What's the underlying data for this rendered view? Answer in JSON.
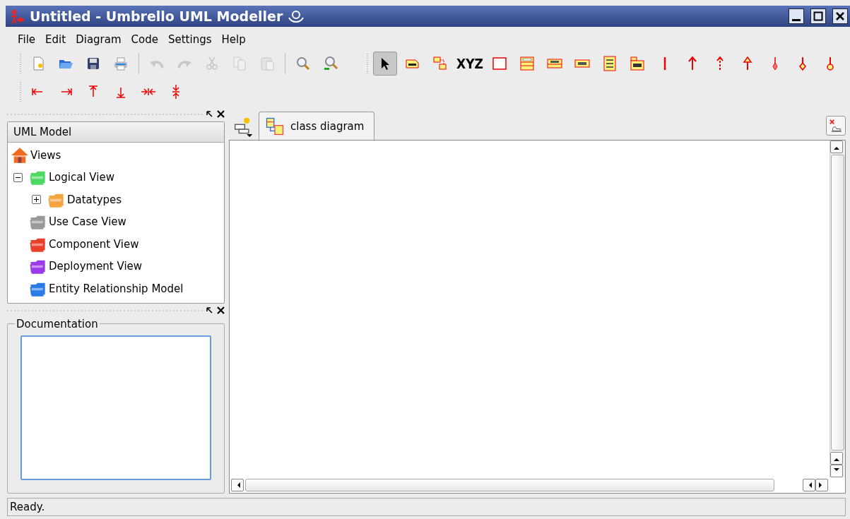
{
  "window": {
    "title": "Untitled - Umbrello UML Modeller"
  },
  "menu": [
    "File",
    "Edit",
    "Diagram",
    "Code",
    "Settings",
    "Help"
  ],
  "toolbar_main": [
    {
      "kind": "new",
      "disabled": false
    },
    {
      "kind": "open",
      "disabled": false
    },
    {
      "kind": "save",
      "disabled": false
    },
    {
      "kind": "print",
      "disabled": false
    },
    {
      "kind": "separator"
    },
    {
      "kind": "undo",
      "disabled": true
    },
    {
      "kind": "redo",
      "disabled": true
    },
    {
      "kind": "cut",
      "disabled": true
    },
    {
      "kind": "copy",
      "disabled": true
    },
    {
      "kind": "paste",
      "disabled": true
    },
    {
      "kind": "separator"
    },
    {
      "kind": "zoom",
      "disabled": false
    },
    {
      "kind": "zoom-reset",
      "disabled": false
    }
  ],
  "toolbar_tools": [
    {
      "kind": "select",
      "selected": true
    },
    {
      "kind": "note",
      "selected": false
    },
    {
      "kind": "anchor",
      "selected": false
    },
    {
      "kind": "text",
      "label": "XYZ",
      "selected": false
    },
    {
      "kind": "box",
      "selected": false
    },
    {
      "kind": "class",
      "selected": false
    },
    {
      "kind": "interface",
      "selected": false
    },
    {
      "kind": "datatype",
      "selected": false
    },
    {
      "kind": "enum",
      "selected": false
    },
    {
      "kind": "package",
      "selected": false
    },
    {
      "kind": "association",
      "selected": false
    },
    {
      "kind": "directed",
      "selected": false
    },
    {
      "kind": "dependency",
      "selected": false
    },
    {
      "kind": "generalization",
      "selected": false
    },
    {
      "kind": "aggregation",
      "selected": false
    },
    {
      "kind": "composition",
      "selected": false
    },
    {
      "kind": "containment",
      "selected": false
    }
  ],
  "toolbar_align": [
    {
      "kind": "align-left"
    },
    {
      "kind": "align-right"
    },
    {
      "kind": "align-top"
    },
    {
      "kind": "align-bottom"
    },
    {
      "kind": "distribute-h"
    },
    {
      "kind": "distribute-v"
    }
  ],
  "tree": {
    "title": "UML Model",
    "items": [
      {
        "label": "Views",
        "kind": "home",
        "children": [
          {
            "label": "Logical View",
            "kind": "folder",
            "color": "#4cd964",
            "expanded": true,
            "children": [
              {
                "label": "Datatypes",
                "kind": "folder",
                "color": "#f5a442",
                "expanded": false
              }
            ]
          },
          {
            "label": "Use Case View",
            "kind": "folder",
            "color": "#9a9a9a"
          },
          {
            "label": "Component View",
            "kind": "folder",
            "color": "#e8402a"
          },
          {
            "label": "Deployment View",
            "kind": "folder",
            "color": "#9a3ae8"
          },
          {
            "label": "Entity Relationship Model",
            "kind": "folder",
            "color": "#2a7ae8"
          }
        ]
      }
    ]
  },
  "documentation": {
    "title": "Documentation"
  },
  "tabs": [
    {
      "label": "class diagram",
      "selected": true
    }
  ],
  "status_bar": "Ready."
}
